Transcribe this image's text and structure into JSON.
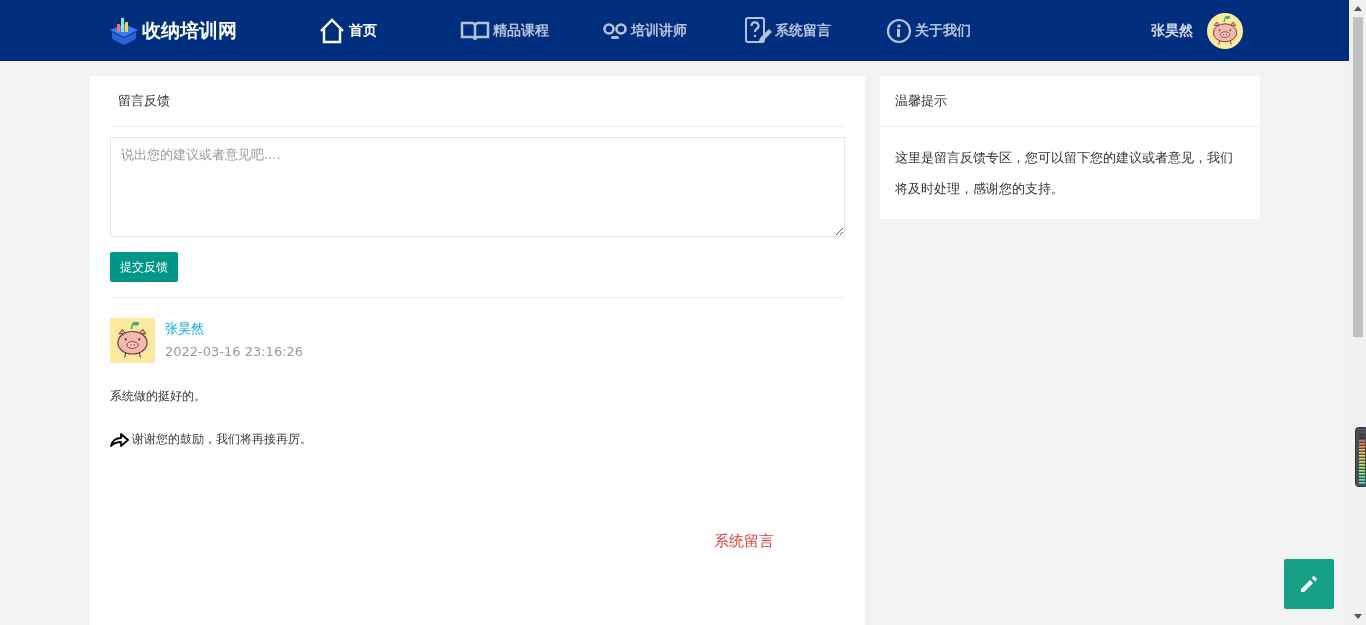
{
  "header": {
    "logo": "收纳培训网",
    "nav": [
      {
        "label": "首页",
        "kind": "home",
        "selected": true
      },
      {
        "label": "精品课程",
        "kind": "book",
        "selected": false
      },
      {
        "label": "培训讲师",
        "kind": "glasses",
        "selected": false
      },
      {
        "label": "系统留言",
        "kind": "question",
        "selected": false
      },
      {
        "label": "关于我们",
        "kind": "info",
        "selected": false
      }
    ],
    "user": "张昊然"
  },
  "feedback": {
    "title": "留言反馈",
    "placeholder": "说出您的建议或者意见吧....",
    "submit": "提交反馈",
    "messages": [
      {
        "author": "张昊然",
        "time": "2022-03-16 23:16:26",
        "content": "系统做的挺好的。",
        "reply": "谢谢您的鼓励，我们将再接再厉。"
      }
    ],
    "floating_label": "系统留言"
  },
  "tips": {
    "title": "温馨提示",
    "text": "这里是留言反馈专区，您可以留下您的建议或者意见，我们将及时处理，感谢您的支持。"
  }
}
